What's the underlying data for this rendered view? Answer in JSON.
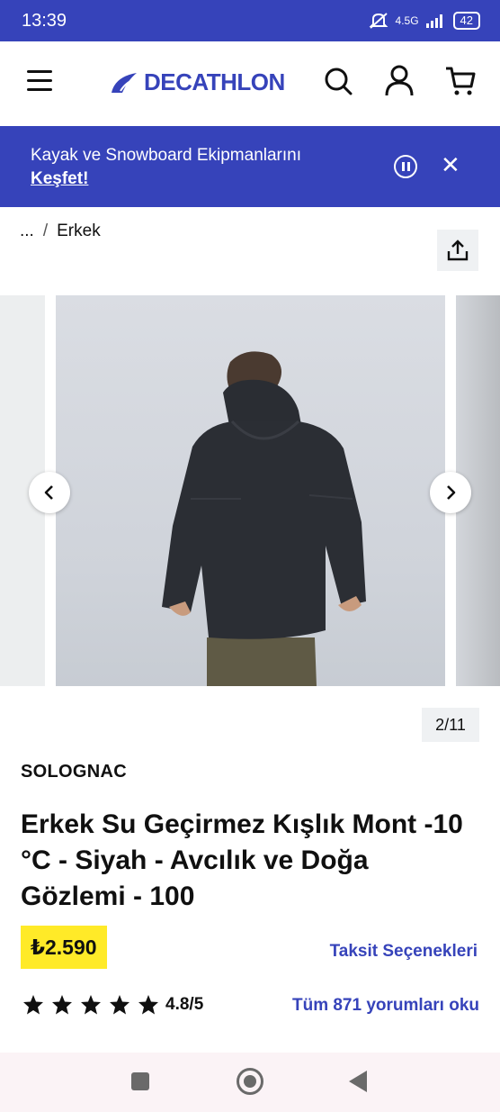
{
  "status_bar": {
    "time": "13:39",
    "network": "4.5G",
    "battery": "42"
  },
  "header": {
    "brand_logo": "DECATHLON",
    "icons": [
      "menu-icon",
      "search-icon",
      "account-icon",
      "cart-icon"
    ]
  },
  "banner": {
    "text": "Kayak ve Snowboard Ekipmanlarını",
    "link": "Keşfet!"
  },
  "breadcrumb": {
    "ellipsis": "...",
    "separator": "/",
    "current": "Erkek"
  },
  "gallery": {
    "counter": "2/11"
  },
  "product": {
    "brand": "SOLOGNAC",
    "title": "Erkek Su Geçirmez Kışlık Mont -10 °C - Siyah - Avcılık ve Doğa Gözlemi - 100",
    "price": "₺2.590",
    "installment_link": "Taksit Seçenekleri",
    "rating_stars": 5,
    "rating_text": "4.8/5",
    "reviews_link": "Tüm 871 yorumları oku"
  },
  "colors": {
    "brand_blue": "#3643ba",
    "price_yellow": "#ffea28"
  }
}
